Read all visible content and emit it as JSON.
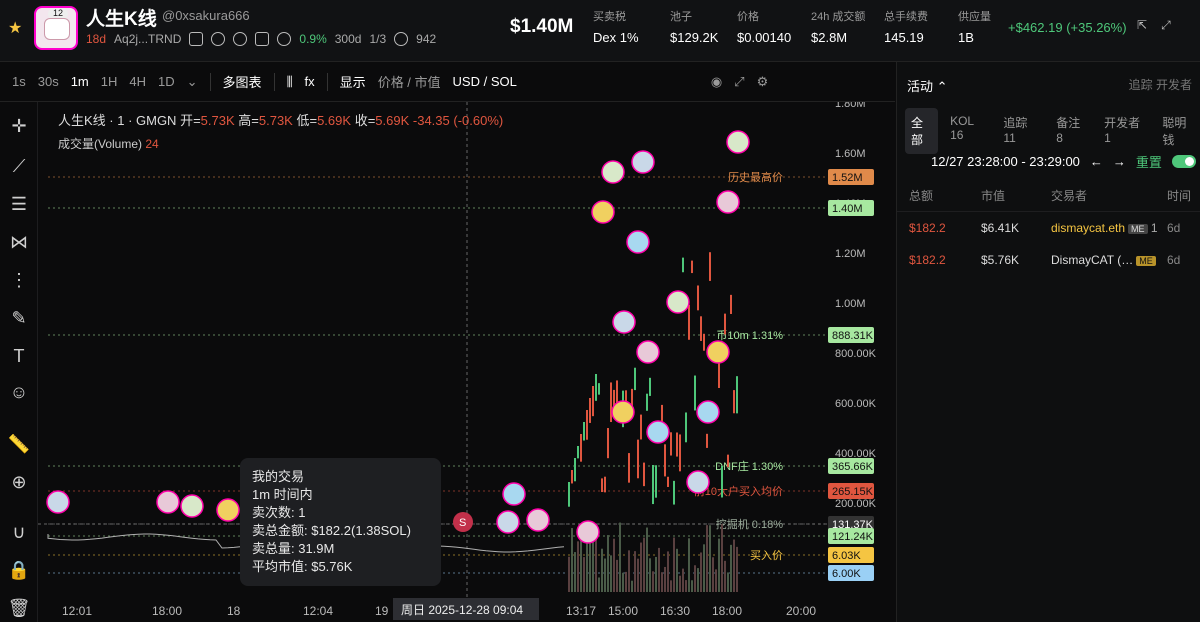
{
  "header": {
    "avatar_badge": "12",
    "title": "人生K线",
    "handle": "@0xsakura666",
    "age": "18d",
    "address": "Aq2j...TRND",
    "holder_pct": "0.9%",
    "holder_dur": "300d",
    "ratio": "1/3",
    "views": "942",
    "price_big": "$1.40M",
    "stats": [
      {
        "label": "买卖税",
        "value": "Dex 1%"
      },
      {
        "label": "池子",
        "value": "$129.2K"
      },
      {
        "label": "价格",
        "value": "$0.00140"
      },
      {
        "label": "24h 成交额",
        "value": "$2.8M"
      },
      {
        "label": "总手续费",
        "value": "145.19"
      },
      {
        "label": "供应量",
        "value": "1B"
      }
    ],
    "change": "+$462.19 (+35.26%)"
  },
  "toolbar": {
    "intervals": [
      "1s",
      "30s",
      "1m",
      "1H",
      "4H",
      "1D"
    ],
    "active_interval": "1m",
    "multi_chart": "多图表",
    "display": "显示",
    "price_mcap": "价格 / 市值",
    "currency": "USD / SOL"
  },
  "legend": {
    "name": "人生K线 · 1 · GMGN",
    "open_lbl": "开=",
    "open": "5.73K",
    "high_lbl": "高=",
    "high": "5.73K",
    "low_lbl": "低=",
    "low": "5.69K",
    "close_lbl": "收=",
    "close": "5.69K",
    "delta": "-34.35 (-0.60%)",
    "volume_lbl": "成交量(Volume)",
    "volume": "24"
  },
  "chart_data": {
    "type": "candlestick",
    "y_axis_ticks": [
      "1.80M",
      "1.60M",
      "1.40M",
      "1.20M",
      "1.00M",
      "800.00K",
      "600.00K",
      "400.00K",
      "200.00K"
    ],
    "x_axis_ticks": [
      "12:01",
      "18:00",
      "18",
      "12:04",
      "19",
      "13:17",
      "15:00",
      "16:30",
      "18:00",
      "20:00"
    ],
    "crosshair_label": "周日 2025-12-28  09:04",
    "price_tags": [
      {
        "value": "1.52M",
        "label": "历史最高价",
        "color": "#e08a4a"
      },
      {
        "value": "1.40M",
        "label": "",
        "color": "#a7e8a0"
      },
      {
        "value": "888.31K",
        "label": "币10m 1.31%",
        "color": "#a7e8a0"
      },
      {
        "value": "365.66K",
        "label": "DNF庄 1.30%",
        "color": "#a7e8a0"
      },
      {
        "value": "265.15K",
        "label": "前10大户买入均价",
        "color": "#e0563f"
      },
      {
        "value": "131.37K",
        "label": "挖掘机 0.18%",
        "color": "#333"
      },
      {
        "value": "121.24K",
        "label": "",
        "color": "#a7e8a0"
      },
      {
        "value": "6.03K",
        "label": "买入价",
        "color": "#f5c542"
      },
      {
        "value": "6.00K",
        "label": "",
        "color": "#9ad0f5"
      }
    ]
  },
  "tooltip": {
    "title": "我的交易",
    "period": "1m 时间内",
    "sell_count": "卖次数: 1",
    "sell_amount": "卖总金额: $182.2(1.38SOL)",
    "sell_volume": "卖总量: 31.9M",
    "avg_mcap": "平均市值: $5.76K"
  },
  "activity": {
    "header": "活动",
    "header_right": "追踪  开发者",
    "tabs": [
      "全部",
      "KOL 16",
      "追踪 11",
      "备注 8",
      "开发者 1",
      "聪明钱"
    ],
    "range": "12/27 23:28:00 - 23:29:00",
    "reset": "重置",
    "columns": [
      "总额",
      "市值",
      "交易者",
      "时间"
    ],
    "rows": [
      {
        "total": "$182.2",
        "mcap": "$6.41K",
        "trader": "dismaycat.eth",
        "tag": "ME",
        "count": "1",
        "time": "6d"
      },
      {
        "total": "$182.2",
        "mcap": "$5.76K",
        "trader": "DismayCAT (…",
        "tag": "ME",
        "count": "",
        "time": "6d"
      }
    ]
  }
}
